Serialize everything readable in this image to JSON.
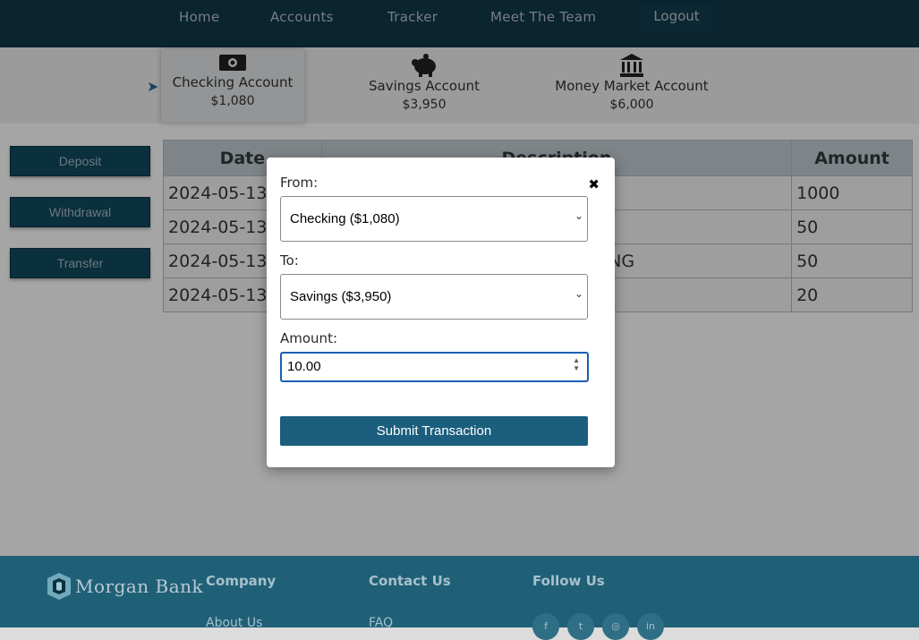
{
  "nav": {
    "items": [
      "Home",
      "Accounts",
      "Tracker",
      "Meet The Team"
    ],
    "logout": "Logout"
  },
  "accounts": [
    {
      "name": "Checking Account",
      "balance": "$1,080",
      "icon": "money-bill-icon",
      "active": true
    },
    {
      "name": "Savings Account",
      "balance": "$3,950",
      "icon": "piggy-bank-icon",
      "active": false
    },
    {
      "name": "Money Market Account",
      "balance": "$6,000",
      "icon": "bank-building-icon",
      "active": false
    }
  ],
  "actions": {
    "deposit": "Deposit",
    "withdrawal": "Withdrawal",
    "transfer": "Transfer"
  },
  "table": {
    "headers": [
      "Date",
      "Description",
      "Amount"
    ],
    "rows": [
      {
        "date": "2024-05-13",
        "description": "",
        "amount": "1000"
      },
      {
        "date": "2024-05-13",
        "description": "",
        "amount": "50"
      },
      {
        "date": "2024-05-13",
        "description": "NG",
        "amount": "50"
      },
      {
        "date": "2024-05-13",
        "description": "",
        "amount": "20"
      }
    ]
  },
  "modal": {
    "from_label": "From:",
    "from_value": "Checking ($1,080)",
    "to_label": "To:",
    "to_value": "Savings ($3,950)",
    "amount_label": "Amount:",
    "amount_value": "10.00",
    "submit": "Submit Transaction",
    "close_icon": "close-icon"
  },
  "footer": {
    "brand": "Morgan Bank",
    "company": "Company",
    "contact": "Contact Us",
    "follow": "Follow Us",
    "about": "About Us",
    "faq": "FAQ"
  },
  "colors": {
    "nav_bg": "#0e3040",
    "accent": "#1b5e7d",
    "footer_bg": "#1f6077"
  }
}
